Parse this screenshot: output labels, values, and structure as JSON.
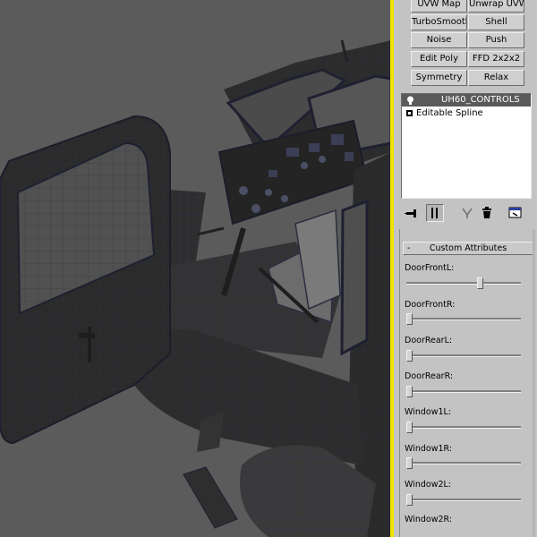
{
  "modifier_buttons": [
    {
      "label": "UVW Map"
    },
    {
      "label": "Unwrap UVW"
    },
    {
      "label": "TurboSmooth"
    },
    {
      "label": "Shell"
    },
    {
      "label": "Noise"
    },
    {
      "label": "Push"
    },
    {
      "label": "Edit Poly"
    },
    {
      "label": "FFD 2x2x2"
    },
    {
      "label": "Symmetry"
    },
    {
      "label": "Relax"
    }
  ],
  "stack": {
    "object_name": "UH60_CONTROLS",
    "base_object": "Editable Spline"
  },
  "stack_tools": [
    "pin-stack-icon",
    "show-end-result-icon",
    "make-unique-icon",
    "remove-modifier-icon",
    "configure-modifier-sets-icon"
  ],
  "rollout": {
    "title": "Custom Attributes",
    "collapse_symbol": "-"
  },
  "attributes": [
    {
      "label": "DoorFrontL:",
      "value": 0.65
    },
    {
      "label": "DoorFrontR:",
      "value": 0.0
    },
    {
      "label": "DoorRearL:",
      "value": 0.0
    },
    {
      "label": "DoorRearR:",
      "value": 0.0
    },
    {
      "label": "Window1L:",
      "value": 0.0
    },
    {
      "label": "Window1R:",
      "value": 0.0
    },
    {
      "label": "Window2L:",
      "value": 0.0
    },
    {
      "label": "Window2R:",
      "value": null
    }
  ],
  "colors": {
    "viewport_bg": "#5b5b5b",
    "active_viewport_border": "#f2e200",
    "panel_bg": "#c3c3c3",
    "stack_selected": "#5a5a5a"
  }
}
